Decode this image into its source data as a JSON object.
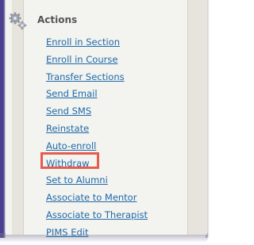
{
  "panel": {
    "title": "Actions",
    "icon": "gears-icon"
  },
  "actions": [
    {
      "label": "Enroll in Section"
    },
    {
      "label": "Enroll in Course"
    },
    {
      "label": "Transfer Sections"
    },
    {
      "label": "Send Email"
    },
    {
      "label": "Send SMS"
    },
    {
      "label": "Reinstate"
    },
    {
      "label": "Auto-enroll"
    },
    {
      "label": "Withdraw",
      "highlighted": true
    },
    {
      "label": "Set to Alumni"
    },
    {
      "label": "Associate to Mentor"
    },
    {
      "label": "Associate to Therapist"
    },
    {
      "label": "PIMS Edit"
    }
  ],
  "colors": {
    "link": "#1f6aa8",
    "highlight": "#e85c4f",
    "window_edge": "#4b3f8f",
    "panel_bg": "#f3f3f0"
  }
}
